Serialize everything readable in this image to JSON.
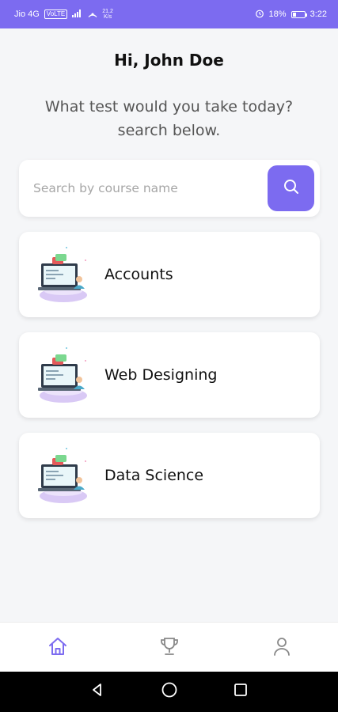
{
  "status_bar": {
    "carrier": "Jio 4G",
    "volte_badge": "VoLTE",
    "signal_label": "4G",
    "speed_value": "21.2",
    "speed_unit": "K/s",
    "battery_percent": "18%",
    "time": "3:22"
  },
  "header": {
    "greeting": "Hi, John Doe",
    "subtitle_line1": "What test would you take today?",
    "subtitle_line2": "search below."
  },
  "search": {
    "placeholder": "Search by course name",
    "value": ""
  },
  "courses": [
    {
      "label": "Accounts",
      "icon": "laptop-teacher-illustration"
    },
    {
      "label": "Web Designing",
      "icon": "laptop-teacher-illustration"
    },
    {
      "label": "Data Science",
      "icon": "laptop-teacher-illustration"
    }
  ],
  "bottom_nav": {
    "items": [
      {
        "icon": "home-icon",
        "active": true
      },
      {
        "icon": "trophy-icon",
        "active": false
      },
      {
        "icon": "user-icon",
        "active": false
      }
    ]
  },
  "theme": {
    "accent": "#7c6bf0",
    "background": "#f5f6f8",
    "card": "#ffffff"
  }
}
